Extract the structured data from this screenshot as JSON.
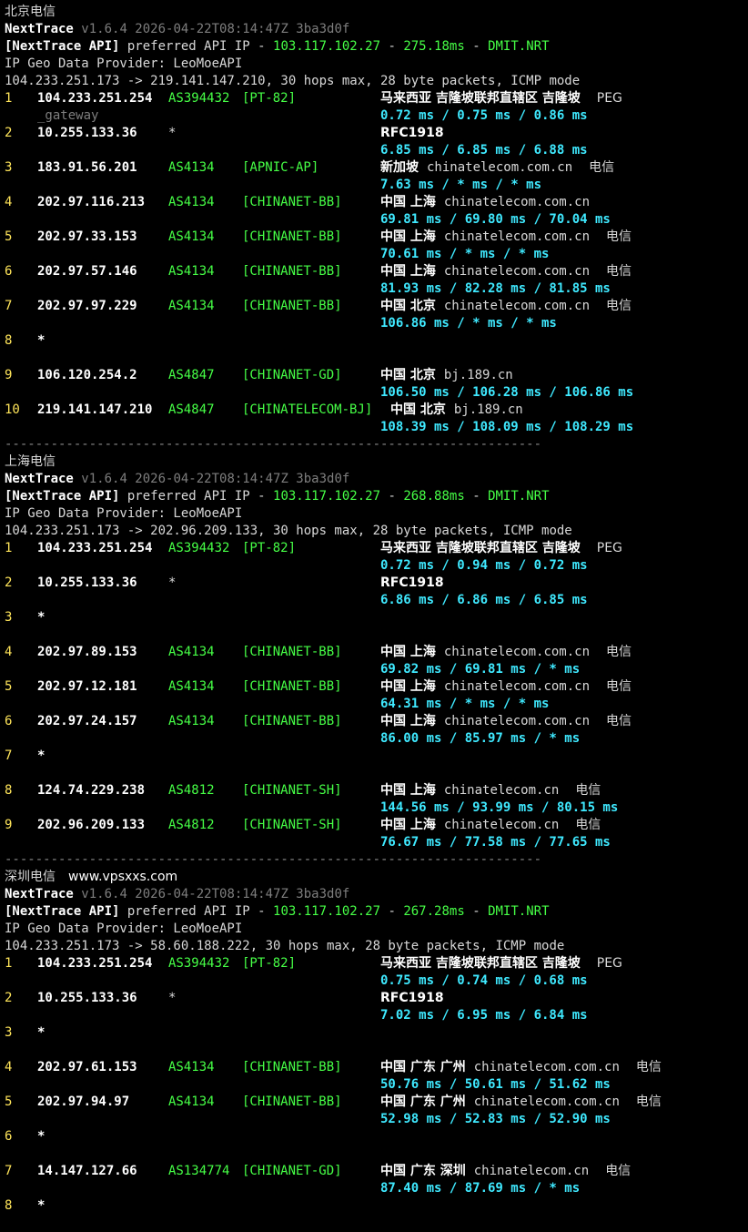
{
  "separator": "----------------------------------------------------------------------",
  "sections": [
    {
      "title": "北京电信",
      "brand": "NextTrace",
      "version": "v1.6.4 2026-04-22T08:14:47Z 3ba3d0f",
      "api_tag": "[NextTrace API]",
      "api_text": " preferred API IP - ",
      "api_ip": "103.117.102.27",
      "api_dash": " - ",
      "api_ms": "275.18ms",
      "api_dash2": " - ",
      "api_node": "DMIT.NRT",
      "geo_provider": "IP Geo Data Provider: LeoMoeAPI",
      "route": "104.233.251.173 -> 219.141.147.210, 30 hops max, 28 byte packets, ICMP mode",
      "hops": [
        {
          "n": "1",
          "ip": "104.233.251.254",
          "asn": "AS394432",
          "prefix": "[PT-82]",
          "geo": "马来西亚 吉隆坡联邦直辖区 吉隆坡",
          "domain": "",
          "isp": "PEG",
          "extra": "_gateway",
          "rtt": "0.72 ms / 0.75 ms / 0.86 ms"
        },
        {
          "n": "2",
          "ip": "10.255.133.36",
          "asn": "*",
          "prefix": "",
          "geo": "RFC1918",
          "domain": "",
          "isp": "",
          "extra": "",
          "rtt": "6.85 ms / 6.85 ms / 6.88 ms"
        },
        {
          "n": "3",
          "ip": "183.91.56.201",
          "asn": "AS4134",
          "prefix": "[APNIC-AP]",
          "geo": "新加坡",
          "domain": "chinatelecom.com.cn",
          "isp": "电信",
          "extra": "",
          "rtt": "7.63 ms / * ms / * ms"
        },
        {
          "n": "4",
          "ip": "202.97.116.213",
          "asn": "AS4134",
          "prefix": "[CHINANET-BB]",
          "geo": "中国 上海",
          "domain": "chinatelecom.com.cn",
          "isp": "",
          "extra": "",
          "rtt": "69.81 ms / 69.80 ms / 70.04 ms"
        },
        {
          "n": "5",
          "ip": "202.97.33.153",
          "asn": "AS4134",
          "prefix": "[CHINANET-BB]",
          "geo": "中国 上海",
          "domain": "chinatelecom.com.cn",
          "isp": "电信",
          "extra": "",
          "rtt": "70.61 ms / * ms / * ms"
        },
        {
          "n": "6",
          "ip": "202.97.57.146",
          "asn": "AS4134",
          "prefix": "[CHINANET-BB]",
          "geo": "中国 上海",
          "domain": "chinatelecom.com.cn",
          "isp": "电信",
          "extra": "",
          "rtt": "81.93 ms / 82.28 ms / 81.85 ms"
        },
        {
          "n": "7",
          "ip": "202.97.97.229",
          "asn": "AS4134",
          "prefix": "[CHINANET-BB]",
          "geo": "中国 北京",
          "domain": "chinatelecom.com.cn",
          "isp": "电信",
          "extra": "",
          "rtt": "106.86 ms / * ms / * ms"
        },
        {
          "n": "8",
          "ip": "*",
          "asn": "",
          "prefix": "",
          "geo": "",
          "domain": "",
          "isp": "",
          "extra": "",
          "rtt": ""
        },
        {
          "n": "9",
          "ip": "106.120.254.2",
          "asn": "AS4847",
          "prefix": "[CHINANET-GD]",
          "geo": "中国 北京",
          "domain": "bj.189.cn",
          "isp": "",
          "extra": "",
          "rtt": "106.50 ms / 106.28 ms / 106.86 ms"
        },
        {
          "n": "10",
          "ip": "219.141.147.210",
          "asn": "AS4847",
          "prefix": "[CHINATELECOM-BJ]",
          "geo": "中国 北京",
          "domain": "bj.189.cn",
          "isp": "",
          "extra": "",
          "rtt": "108.39 ms / 108.09 ms / 108.29 ms"
        }
      ]
    },
    {
      "title": "上海电信",
      "brand": "NextTrace",
      "version": "v1.6.4 2026-04-22T08:14:47Z 3ba3d0f",
      "api_tag": "[NextTrace API]",
      "api_text": " preferred API IP - ",
      "api_ip": "103.117.102.27",
      "api_dash": " - ",
      "api_ms": "268.88ms",
      "api_dash2": " - ",
      "api_node": "DMIT.NRT",
      "geo_provider": "IP Geo Data Provider: LeoMoeAPI",
      "route": "104.233.251.173 -> 202.96.209.133, 30 hops max, 28 byte packets, ICMP mode",
      "hops": [
        {
          "n": "1",
          "ip": "104.233.251.254",
          "asn": "AS394432",
          "prefix": "[PT-82]",
          "geo": "马来西亚 吉隆坡联邦直辖区 吉隆坡",
          "domain": "",
          "isp": "PEG",
          "extra": "",
          "rtt": "0.72 ms / 0.94 ms / 0.72 ms"
        },
        {
          "n": "2",
          "ip": "10.255.133.36",
          "asn": "*",
          "prefix": "",
          "geo": "RFC1918",
          "domain": "",
          "isp": "",
          "extra": "",
          "rtt": "6.86 ms / 6.86 ms / 6.85 ms"
        },
        {
          "n": "3",
          "ip": "*",
          "asn": "",
          "prefix": "",
          "geo": "",
          "domain": "",
          "isp": "",
          "extra": "",
          "rtt": ""
        },
        {
          "n": "4",
          "ip": "202.97.89.153",
          "asn": "AS4134",
          "prefix": "[CHINANET-BB]",
          "geo": "中国 上海",
          "domain": "chinatelecom.com.cn",
          "isp": "电信",
          "extra": "",
          "rtt": "69.82 ms / 69.81 ms / * ms"
        },
        {
          "n": "5",
          "ip": "202.97.12.181",
          "asn": "AS4134",
          "prefix": "[CHINANET-BB]",
          "geo": "中国 上海",
          "domain": "chinatelecom.com.cn",
          "isp": "电信",
          "extra": "",
          "rtt": "64.31 ms / * ms / * ms"
        },
        {
          "n": "6",
          "ip": "202.97.24.157",
          "asn": "AS4134",
          "prefix": "[CHINANET-BB]",
          "geo": "中国 上海",
          "domain": "chinatelecom.com.cn",
          "isp": "电信",
          "extra": "",
          "rtt": "86.00 ms / 85.97 ms / * ms"
        },
        {
          "n": "7",
          "ip": "*",
          "asn": "",
          "prefix": "",
          "geo": "",
          "domain": "",
          "isp": "",
          "extra": "",
          "rtt": ""
        },
        {
          "n": "8",
          "ip": "124.74.229.238",
          "asn": "AS4812",
          "prefix": "[CHINANET-SH]",
          "geo": "中国 上海",
          "domain": "chinatelecom.cn",
          "isp": "电信",
          "extra": "",
          "rtt": "144.56 ms / 93.99 ms / 80.15 ms"
        },
        {
          "n": "9",
          "ip": "202.96.209.133",
          "asn": "AS4812",
          "prefix": "[CHINANET-SH]",
          "geo": "中国 上海",
          "domain": "chinatelecom.cn",
          "isp": "电信",
          "extra": "",
          "rtt": "76.67 ms / 77.58 ms / 77.65 ms"
        }
      ]
    },
    {
      "title": "深圳电信",
      "watermark": "www.vpsxxs.com",
      "brand": "NextTrace",
      "version": "v1.6.4 2026-04-22T08:14:47Z 3ba3d0f",
      "api_tag": "[NextTrace API]",
      "api_text": " preferred API IP - ",
      "api_ip": "103.117.102.27",
      "api_dash": " - ",
      "api_ms": "267.28ms",
      "api_dash2": " - ",
      "api_node": "DMIT.NRT",
      "geo_provider": "IP Geo Data Provider: LeoMoeAPI",
      "route": "104.233.251.173 -> 58.60.188.222, 30 hops max, 28 byte packets, ICMP mode",
      "hops": [
        {
          "n": "1",
          "ip": "104.233.251.254",
          "asn": "AS394432",
          "prefix": "[PT-82]",
          "geo": "马来西亚 吉隆坡联邦直辖区 吉隆坡",
          "domain": "",
          "isp": "PEG",
          "extra": "",
          "rtt": "0.75 ms / 0.74 ms / 0.68 ms"
        },
        {
          "n": "2",
          "ip": "10.255.133.36",
          "asn": "*",
          "prefix": "",
          "geo": "RFC1918",
          "domain": "",
          "isp": "",
          "extra": "",
          "rtt": "7.02 ms / 6.95 ms / 6.84 ms"
        },
        {
          "n": "3",
          "ip": "*",
          "asn": "",
          "prefix": "",
          "geo": "",
          "domain": "",
          "isp": "",
          "extra": "",
          "rtt": ""
        },
        {
          "n": "4",
          "ip": "202.97.61.153",
          "asn": "AS4134",
          "prefix": "[CHINANET-BB]",
          "geo": "中国 广东 广州",
          "domain": "chinatelecom.com.cn",
          "isp": "电信",
          "extra": "",
          "rtt": "50.76 ms / 50.61 ms / 51.62 ms"
        },
        {
          "n": "5",
          "ip": "202.97.94.97",
          "asn": "AS4134",
          "prefix": "[CHINANET-BB]",
          "geo": "中国 广东 广州",
          "domain": "chinatelecom.com.cn",
          "isp": "电信",
          "extra": "",
          "rtt": "52.98 ms / 52.83 ms / 52.90 ms"
        },
        {
          "n": "6",
          "ip": "*",
          "asn": "",
          "prefix": "",
          "geo": "",
          "domain": "",
          "isp": "",
          "extra": "",
          "rtt": ""
        },
        {
          "n": "7",
          "ip": "14.147.127.66",
          "asn": "AS134774",
          "prefix": "[CHINANET-GD]",
          "geo": "中国 广东 深圳",
          "domain": "chinatelecom.cn",
          "isp": "电信",
          "extra": "",
          "rtt": "87.40 ms / 87.69 ms / * ms"
        },
        {
          "n": "8",
          "ip": "*",
          "asn": "",
          "prefix": "",
          "geo": "",
          "domain": "",
          "isp": "",
          "extra": "",
          "rtt": ""
        }
      ]
    }
  ]
}
